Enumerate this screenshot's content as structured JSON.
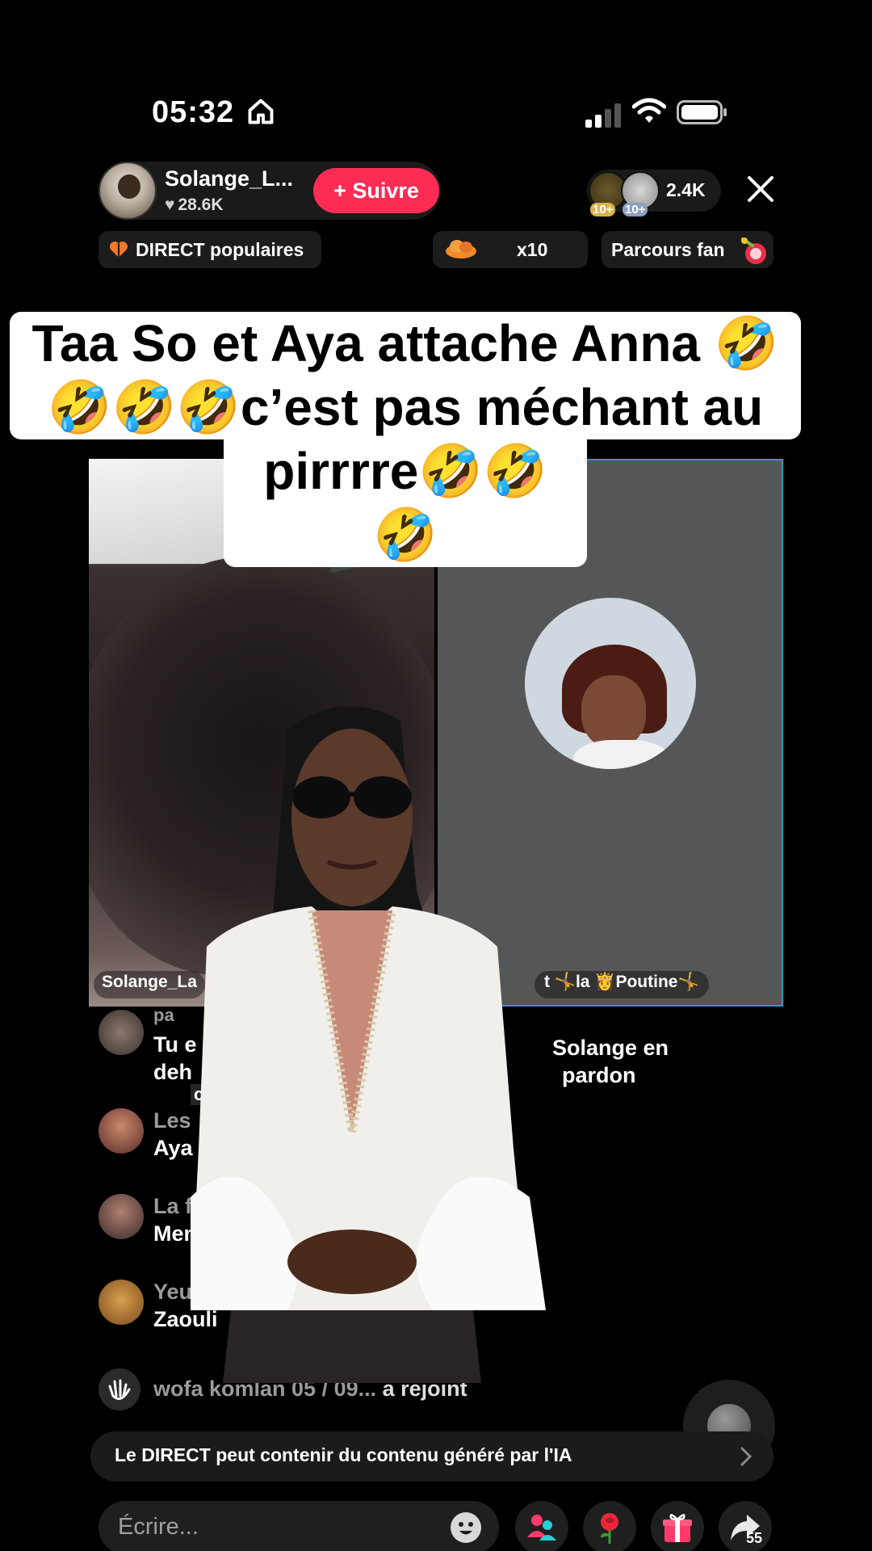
{
  "status_bar": {
    "time": "05:32"
  },
  "host": {
    "name": "Solange_L...",
    "likes": "28.6K",
    "follow_label": "+ Suivre"
  },
  "viewers": {
    "badge_1": "10+",
    "badge_2": "10+",
    "count": "2.4K"
  },
  "chips": {
    "popular": "DIRECT populaires",
    "multiplier": "x10",
    "fan_journey": "Parcours fan"
  },
  "caption": {
    "line1": "Taa So et Aya attache Anna 🤣",
    "line2": "🤣🤣🤣c’est pas méchant au",
    "line3": "pirrrre🤣🤣🤣"
  },
  "video": {
    "left_label": "Solange_La",
    "right_label": "t 🤸la 👸Poutine🤸"
  },
  "chat": {
    "messages": [
      {
        "user": "pa",
        "text_1": "Tu e",
        "text_2": "deh"
      },
      {
        "user": "Les",
        "text_1": "Aya"
      },
      {
        "user": "La fi",
        "text_1": "Men"
      },
      {
        "user": "Yeux c",
        "text_1": "Zaouli"
      }
    ],
    "right_line_1": "Solange en",
    "right_line_2": "pardon",
    "overlay_tag": "ctures"
  },
  "join": {
    "user": "wofa komlan 05 / 09...",
    "action": "a rejoint"
  },
  "ai_notice": "Le DIRECT peut contenir du contenu généré par l'IA",
  "composer": {
    "placeholder": "Écrire..."
  },
  "share_count": "55",
  "colors": {
    "accent": "#fe2c55",
    "guest_border": "#1aa3c2",
    "background": "#000000"
  },
  "icons": [
    "home-icon",
    "signal-icon",
    "wifi-icon",
    "battery-icon",
    "close-icon",
    "heart-icon",
    "cloud-icon",
    "gift-icon",
    "rose-icon",
    "share-icon",
    "emoji-icon",
    "multi-guest-icon",
    "wave-icon",
    "chevron-right-icon"
  ]
}
